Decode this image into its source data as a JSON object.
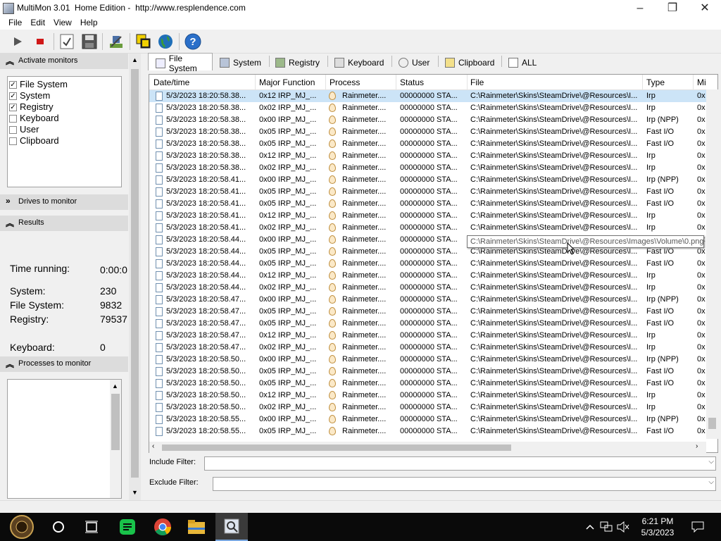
{
  "window": {
    "title": "MultiMon 3.01  Home Edition -  http://www.resplendence.com",
    "minimize": "–",
    "maximize": "❐",
    "close": "✕"
  },
  "menu": [
    "File",
    "Edit",
    "View",
    "Help"
  ],
  "toolbar": {
    "icons": [
      "play-icon",
      "stop-icon",
      "checklist-icon",
      "save-icon",
      "tools-icon",
      "windows-icon",
      "globe-icon",
      "help-icon"
    ]
  },
  "left_panel": {
    "activate_header": "Activate monitors",
    "monitors": [
      {
        "label": "File System",
        "checked": true
      },
      {
        "label": "System",
        "checked": true
      },
      {
        "label": "Registry",
        "checked": true
      },
      {
        "label": "Keyboard",
        "checked": false
      },
      {
        "label": "User",
        "checked": false
      },
      {
        "label": "Clipboard",
        "checked": false
      }
    ],
    "drives_header": "Drives to monitor",
    "results_header": "Results",
    "results": [
      {
        "label": "Time running:",
        "value": "0:00:0"
      },
      {
        "label": "System:",
        "value": "230"
      },
      {
        "label": "File System:",
        "value": "9832"
      },
      {
        "label": "Registry:",
        "value": "79537"
      },
      {
        "label": "Keyboard:",
        "value": "0"
      }
    ],
    "processes_header": "Processes to monitor"
  },
  "tabs": [
    {
      "label": "File System",
      "active": true
    },
    {
      "label": "System",
      "active": false
    },
    {
      "label": "Registry",
      "active": false
    },
    {
      "label": "Keyboard",
      "active": false
    },
    {
      "label": "User",
      "active": false
    },
    {
      "label": "Clipboard",
      "active": false
    },
    {
      "label": "ALL",
      "active": false
    }
  ],
  "grid": {
    "columns": [
      "Date/time",
      "Major Function",
      "Process",
      "Status",
      "File",
      "Type",
      "Mi"
    ],
    "rows": [
      [
        "5/3/2023 18:20:58.38...",
        "0x12  IRP_MJ_...",
        "Rainmeter....",
        "00000000  STA...",
        "C:\\Rainmeter\\Skins\\SteamDrive\\@Resources\\I...",
        "Irp",
        "0x"
      ],
      [
        "5/3/2023 18:20:58.38...",
        "0x02  IRP_MJ_...",
        "Rainmeter....",
        "00000000  STA...",
        "C:\\Rainmeter\\Skins\\SteamDrive\\@Resources\\I...",
        "Irp",
        "0x"
      ],
      [
        "5/3/2023 18:20:58.38...",
        "0x00  IRP_MJ_...",
        "Rainmeter....",
        "00000000  STA...",
        "C:\\Rainmeter\\Skins\\SteamDrive\\@Resources\\I...",
        "Irp  (NPP)",
        "0x"
      ],
      [
        "5/3/2023 18:20:58.38...",
        "0x05  IRP_MJ_...",
        "Rainmeter....",
        "00000000  STA...",
        "C:\\Rainmeter\\Skins\\SteamDrive\\@Resources\\I...",
        "Fast I/O",
        "0x"
      ],
      [
        "5/3/2023 18:20:58.38...",
        "0x05  IRP_MJ_...",
        "Rainmeter....",
        "00000000  STA...",
        "C:\\Rainmeter\\Skins\\SteamDrive\\@Resources\\I...",
        "Fast I/O",
        "0x"
      ],
      [
        "5/3/2023 18:20:58.38...",
        "0x12  IRP_MJ_...",
        "Rainmeter....",
        "00000000  STA...",
        "C:\\Rainmeter\\Skins\\SteamDrive\\@Resources\\I...",
        "Irp",
        "0x"
      ],
      [
        "5/3/2023 18:20:58.38...",
        "0x02  IRP_MJ_...",
        "Rainmeter....",
        "00000000  STA...",
        "C:\\Rainmeter\\Skins\\SteamDrive\\@Resources\\I...",
        "Irp",
        "0x"
      ],
      [
        "5/3/2023 18:20:58.41...",
        "0x00  IRP_MJ_...",
        "Rainmeter....",
        "00000000  STA...",
        "C:\\Rainmeter\\Skins\\SteamDrive\\@Resources\\I...",
        "Irp  (NPP)",
        "0x"
      ],
      [
        "5/3/2023 18:20:58.41...",
        "0x05  IRP_MJ_...",
        "Rainmeter....",
        "00000000  STA...",
        "C:\\Rainmeter\\Skins\\SteamDrive\\@Resources\\I...",
        "Fast I/O",
        "0x"
      ],
      [
        "5/3/2023 18:20:58.41...",
        "0x05  IRP_MJ_...",
        "Rainmeter....",
        "00000000  STA...",
        "C:\\Rainmeter\\Skins\\SteamDrive\\@Resources\\I...",
        "Fast I/O",
        "0x"
      ],
      [
        "5/3/2023 18:20:58.41...",
        "0x12  IRP_MJ_...",
        "Rainmeter....",
        "00000000  STA...",
        "C:\\Rainmeter\\Skins\\SteamDrive\\@Resources\\I...",
        "Irp",
        "0x"
      ],
      [
        "5/3/2023 18:20:58.41...",
        "0x02  IRP_MJ_...",
        "Rainmeter....",
        "00000000  STA...",
        "C:\\Rainmeter\\Skins\\SteamDrive\\@Resources\\I...",
        "Irp",
        "0x"
      ],
      [
        "5/3/2023 18:20:58.44...",
        "0x00  IRP_MJ_...",
        "Rainmeter....",
        "00000000  STA...",
        "C:\\Rainmeter\\Skins\\SteamDrive\\@Resources\\I...",
        "Irp  (NPP)",
        "0x"
      ],
      [
        "5/3/2023 18:20:58.44...",
        "0x05  IRP_MJ_...",
        "Rainmeter....",
        "00000000  STA...",
        "C:\\Rainmeter\\Skins\\SteamDrive\\@Resources\\I...",
        "Fast I/O",
        "0x"
      ],
      [
        "5/3/2023 18:20:58.44...",
        "0x05  IRP_MJ_...",
        "Rainmeter....",
        "00000000  STA...",
        "C:\\Rainmeter\\Skins\\SteamDrive\\@Resources\\I...",
        "Fast I/O",
        "0x"
      ],
      [
        "5/3/2023 18:20:58.44...",
        "0x12  IRP_MJ_...",
        "Rainmeter....",
        "00000000  STA...",
        "C:\\Rainmeter\\Skins\\SteamDrive\\@Resources\\I...",
        "Irp",
        "0x"
      ],
      [
        "5/3/2023 18:20:58.44...",
        "0x02  IRP_MJ_...",
        "Rainmeter....",
        "00000000  STA...",
        "C:\\Rainmeter\\Skins\\SteamDrive\\@Resources\\I...",
        "Irp",
        "0x"
      ],
      [
        "5/3/2023 18:20:58.47...",
        "0x00  IRP_MJ_...",
        "Rainmeter....",
        "00000000  STA...",
        "C:\\Rainmeter\\Skins\\SteamDrive\\@Resources\\I...",
        "Irp  (NPP)",
        "0x"
      ],
      [
        "5/3/2023 18:20:58.47...",
        "0x05  IRP_MJ_...",
        "Rainmeter....",
        "00000000  STA...",
        "C:\\Rainmeter\\Skins\\SteamDrive\\@Resources\\I...",
        "Fast I/O",
        "0x"
      ],
      [
        "5/3/2023 18:20:58.47...",
        "0x05  IRP_MJ_...",
        "Rainmeter....",
        "00000000  STA...",
        "C:\\Rainmeter\\Skins\\SteamDrive\\@Resources\\I...",
        "Fast I/O",
        "0x"
      ],
      [
        "5/3/2023 18:20:58.47...",
        "0x12  IRP_MJ_...",
        "Rainmeter....",
        "00000000  STA...",
        "C:\\Rainmeter\\Skins\\SteamDrive\\@Resources\\I...",
        "Irp",
        "0x"
      ],
      [
        "5/3/2023 18:20:58.47...",
        "0x02  IRP_MJ_...",
        "Rainmeter....",
        "00000000  STA...",
        "C:\\Rainmeter\\Skins\\SteamDrive\\@Resources\\I...",
        "Irp",
        "0x"
      ],
      [
        "5/3/2023 18:20:58.50...",
        "0x00  IRP_MJ_...",
        "Rainmeter....",
        "00000000  STA...",
        "C:\\Rainmeter\\Skins\\SteamDrive\\@Resources\\I...",
        "Irp  (NPP)",
        "0x"
      ],
      [
        "5/3/2023 18:20:58.50...",
        "0x05  IRP_MJ_...",
        "Rainmeter....",
        "00000000  STA...",
        "C:\\Rainmeter\\Skins\\SteamDrive\\@Resources\\I...",
        "Fast I/O",
        "0x"
      ],
      [
        "5/3/2023 18:20:58.50...",
        "0x05  IRP_MJ_...",
        "Rainmeter....",
        "00000000  STA...",
        "C:\\Rainmeter\\Skins\\SteamDrive\\@Resources\\I...",
        "Fast I/O",
        "0x"
      ],
      [
        "5/3/2023 18:20:58.50...",
        "0x12  IRP_MJ_...",
        "Rainmeter....",
        "00000000  STA...",
        "C:\\Rainmeter\\Skins\\SteamDrive\\@Resources\\I...",
        "Irp",
        "0x"
      ],
      [
        "5/3/2023 18:20:58.50...",
        "0x02  IRP_MJ_...",
        "Rainmeter....",
        "00000000  STA...",
        "C:\\Rainmeter\\Skins\\SteamDrive\\@Resources\\I...",
        "Irp",
        "0x"
      ],
      [
        "5/3/2023 18:20:58.55...",
        "0x00  IRP_MJ_...",
        "Rainmeter....",
        "00000000  STA...",
        "C:\\Rainmeter\\Skins\\SteamDrive\\@Resources\\I...",
        "Irp  (NPP)",
        "0x"
      ],
      [
        "5/3/2023 18:20:58.55...",
        "0x05  IRP_MJ_...",
        "Rainmeter....",
        "00000000  STA...",
        "C:\\Rainmeter\\Skins\\SteamDrive\\@Resources\\I...",
        "Fast I/O",
        "0x"
      ]
    ]
  },
  "tooltip": "C:\\Rainmeter\\Skins\\SteamDrive\\@Resources\\Images\\Volume\\0.png",
  "filters": {
    "include_label": "Include Filter:",
    "exclude_label": "Exclude Filter:",
    "include_value": "",
    "exclude_value": ""
  },
  "taskbar": {
    "time": "6:21 PM",
    "date": "5/3/2023"
  },
  "colors": {
    "selection": "#cce4f7",
    "taskbar": "#0a0a0a"
  }
}
